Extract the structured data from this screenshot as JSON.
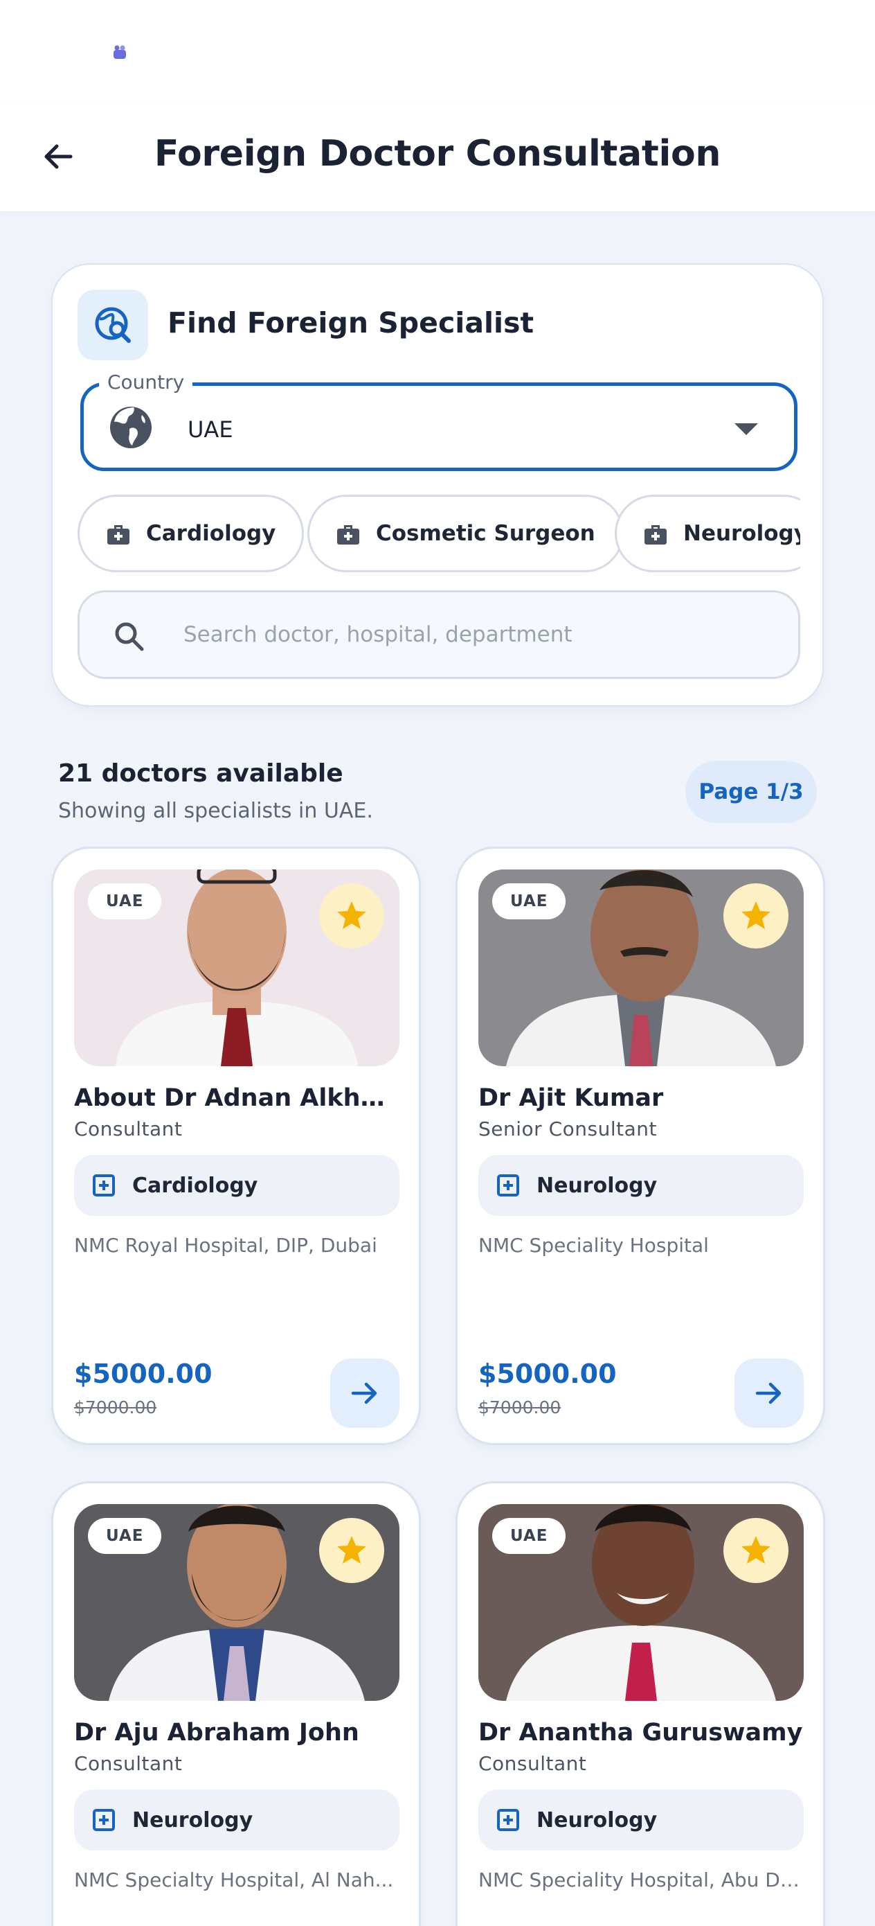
{
  "app_bar": {
    "title": "Foreign Doctor Consultation"
  },
  "search_card": {
    "title": "Find Foreign Specialist",
    "country_label": "Country",
    "country_value": "UAE",
    "chips": [
      {
        "label": "Cardiology"
      },
      {
        "label": "Cosmetic Surgeon"
      },
      {
        "label": "Neurology"
      }
    ],
    "search_placeholder": "Search doctor, hospital, department"
  },
  "results": {
    "count_text": "21 doctors available",
    "subtitle": "Showing all specialists in UAE.",
    "page_badge": "Page 1/3"
  },
  "doctors": [
    {
      "country": "UAE",
      "name": "About Dr Adnan Alkhalef...",
      "role": "Consultant",
      "department": "Cardiology",
      "hospital": "NMC Royal Hospital, DIP, Dubai",
      "price": "$5000.00",
      "old_price": "$7000.00"
    },
    {
      "country": "UAE",
      "name": "Dr Ajit Kumar",
      "role": "Senior Consultant",
      "department": "Neurology",
      "hospital": "NMC Speciality Hospital",
      "price": "$5000.00",
      "old_price": "$7000.00"
    },
    {
      "country": "UAE",
      "name": "Dr Aju Abraham John",
      "role": "Consultant",
      "department": "Neurology",
      "hospital": "NMC Specialty Hospital, Al Nah...",
      "price": "",
      "old_price": ""
    },
    {
      "country": "UAE",
      "name": "Dr Anantha Guruswamy",
      "role": "Consultant",
      "department": "Neurology",
      "hospital": "NMC Speciality Hospital, Abu Dh...",
      "price": "",
      "old_price": ""
    }
  ],
  "colors": {
    "primary": "#1565c0",
    "star": "#f5b301",
    "background": "#f1f5fb"
  }
}
